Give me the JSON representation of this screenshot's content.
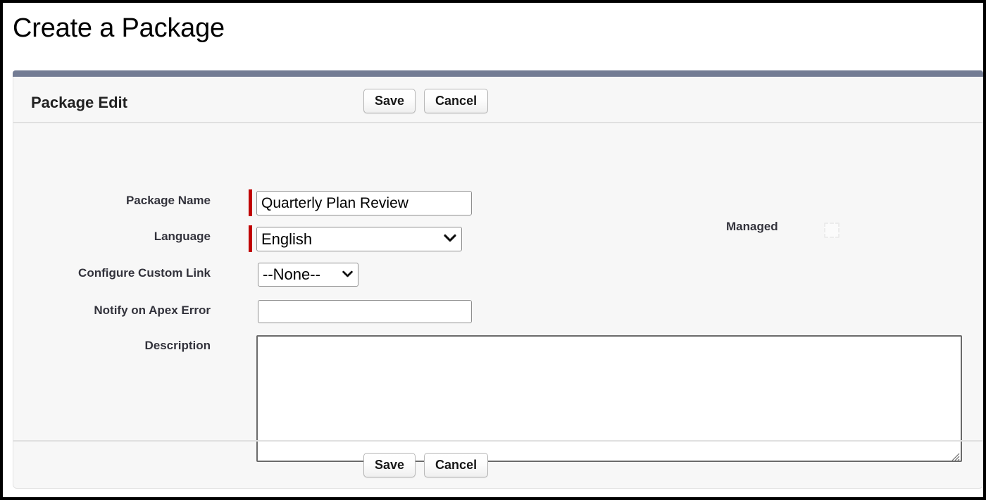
{
  "page": {
    "title": "Create a Package",
    "accent_color": "#737c94",
    "required_marker_color": "#c00000"
  },
  "card": {
    "header_title": "Package Edit",
    "header_buttons": [
      {
        "label": "Save",
        "name": "save-button-top"
      },
      {
        "label": "Cancel",
        "name": "cancel-button-top"
      }
    ],
    "footer_buttons": [
      {
        "label": "Save",
        "name": "save-button-bottom"
      },
      {
        "label": "Cancel",
        "name": "cancel-button-bottom"
      }
    ]
  },
  "form": {
    "fields": {
      "package_name": {
        "label": "Package Name",
        "value": "Quarterly Plan Review",
        "placeholder": "",
        "required": true
      },
      "language": {
        "label": "Language",
        "value": "English",
        "required": true,
        "options": [
          "English"
        ]
      },
      "configure_custom_link": {
        "label": "Configure Custom Link",
        "value": "--None--",
        "required": false,
        "options": [
          "--None--"
        ]
      },
      "notify_on_apex_error": {
        "label": "Notify on Apex Error",
        "value": "",
        "placeholder": "",
        "required": false,
        "lookup_icon": "lookup-search-icon"
      },
      "description": {
        "label": "Description",
        "value": "",
        "placeholder": "",
        "required": false
      },
      "managed": {
        "label": "Managed",
        "checked": false,
        "disabled": true
      }
    }
  },
  "icons": {
    "select_arrow": "chevron-down-icon",
    "lookup": "magnifier-page-icon",
    "resize": "resize-grip-icon"
  }
}
